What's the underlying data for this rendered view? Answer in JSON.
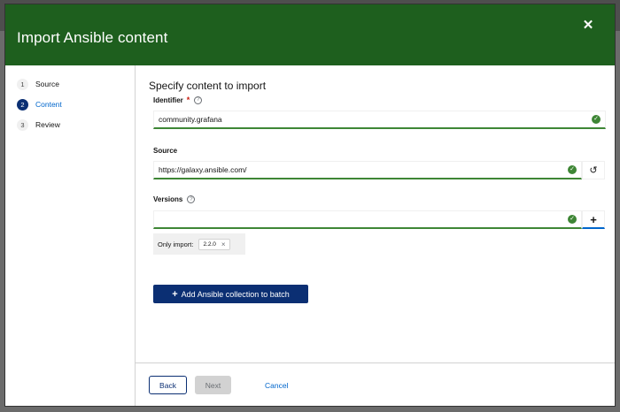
{
  "modal": {
    "title": "Import Ansible content"
  },
  "nav": {
    "steps": [
      {
        "number": "1",
        "label": "Source"
      },
      {
        "number": "2",
        "label": "Content"
      },
      {
        "number": "3",
        "label": "Review"
      }
    ]
  },
  "form": {
    "section_title": "Specify content to import",
    "identifier": {
      "label": "Identifier",
      "required_mark": "*",
      "help": "?",
      "value": "community.grafana",
      "status_icon": "check-circle"
    },
    "source": {
      "label": "Source",
      "value": "https://galaxy.ansible.com/",
      "status_icon": "check-circle",
      "reset_icon": "undo"
    },
    "versions": {
      "label": "Versions",
      "help": "?",
      "value": "",
      "status_icon": "check-circle",
      "add_icon": "+"
    },
    "chip_group": {
      "category": "Only import:",
      "chips": [
        "2.2.0"
      ],
      "remove_glyph": "×"
    },
    "add_button": {
      "plus": "+",
      "label": "Add Ansible collection to batch"
    }
  },
  "footer": {
    "back_label": "Back",
    "next_label": "Next",
    "cancel_label": "Cancel"
  },
  "colors": {
    "header": "#1e5f1e",
    "primary": "#0b2f73",
    "success": "#3e8635",
    "link": "#0066cc"
  }
}
